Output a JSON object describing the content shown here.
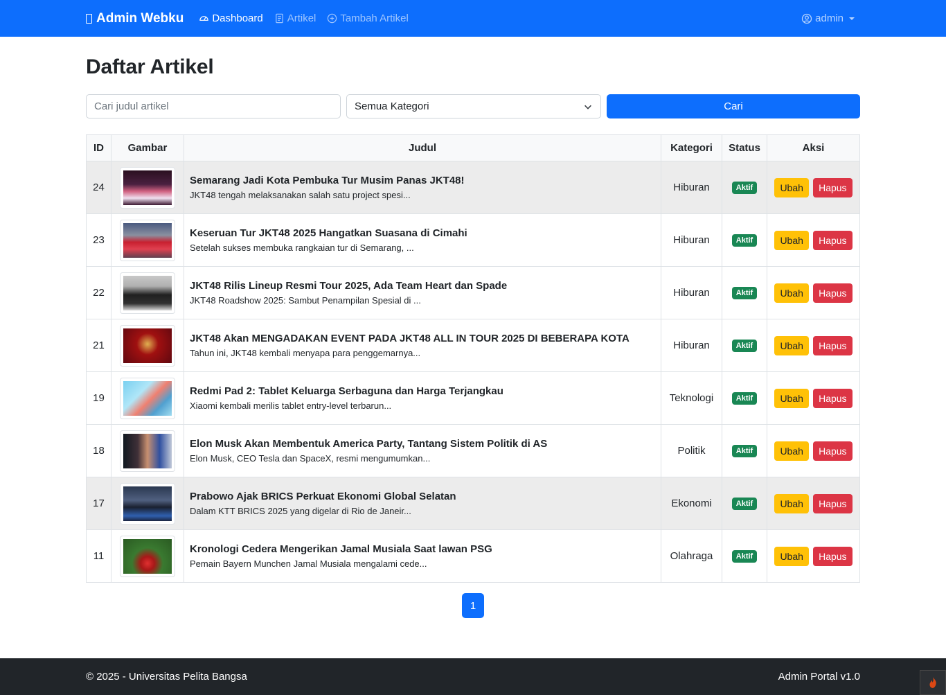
{
  "nav": {
    "brand": "Admin Webku",
    "links": [
      {
        "label": "Dashboard",
        "icon": "speedometer-icon",
        "active": true
      },
      {
        "label": "Artikel",
        "icon": "document-icon",
        "active": false
      },
      {
        "label": "Tambah Artikel",
        "icon": "plus-circle-icon",
        "active": false
      }
    ],
    "user": "admin"
  },
  "page": {
    "title": "Daftar Artikel"
  },
  "search": {
    "placeholder": "Cari judul artikel",
    "category_selected": "Semua Kategori",
    "button": "Cari"
  },
  "table": {
    "headers": [
      "ID",
      "Gambar",
      "Judul",
      "Kategori",
      "Status",
      "Aksi"
    ],
    "rows": [
      {
        "id": "24",
        "title": "Semarang Jadi Kota Pembuka Tur Musim Panas JKT48!",
        "desc": "JKT48 tengah melaksanakan salah satu project spesi...",
        "category": "Hiburan",
        "status": "Aktif",
        "edit": "Ubah",
        "delete": "Hapus",
        "highlight": true
      },
      {
        "id": "23",
        "title": "Keseruan Tur JKT48 2025 Hangatkan Suasana di Cimahi",
        "desc": "Setelah sukses membuka rangkaian tur di Semarang, ...",
        "category": "Hiburan",
        "status": "Aktif",
        "edit": "Ubah",
        "delete": "Hapus",
        "highlight": false
      },
      {
        "id": "22",
        "title": "JKT48 Rilis Lineup Resmi Tour 2025, Ada Team Heart dan Spade",
        "desc": "JKT48 Roadshow 2025: Sambut Penampilan Spesial di ...",
        "category": "Hiburan",
        "status": "Aktif",
        "edit": "Ubah",
        "delete": "Hapus",
        "highlight": false
      },
      {
        "id": "21",
        "title": "JKT48 Akan MENGADAKAN EVENT PADA JKT48 ALL IN TOUR 2025 DI BEBERAPA KOTA",
        "desc": "Tahun ini, JKT48 kembali menyapa para penggemarnya...",
        "category": "Hiburan",
        "status": "Aktif",
        "edit": "Ubah",
        "delete": "Hapus",
        "highlight": false
      },
      {
        "id": "19",
        "title": "Redmi Pad 2: Tablet Keluarga Serbaguna dan Harga Terjangkau",
        "desc": "Xiaomi kembali merilis tablet entry-level terbarun...",
        "category": "Teknologi",
        "status": "Aktif",
        "edit": "Ubah",
        "delete": "Hapus",
        "highlight": false
      },
      {
        "id": "18",
        "title": "Elon Musk Akan Membentuk America Party, Tantang Sistem Politik di AS",
        "desc": "Elon Musk, CEO Tesla dan SpaceX, resmi mengumumkan...",
        "category": "Politik",
        "status": "Aktif",
        "edit": "Ubah",
        "delete": "Hapus",
        "highlight": false
      },
      {
        "id": "17",
        "title": "Prabowo Ajak BRICS Perkuat Ekonomi Global Selatan",
        "desc": "Dalam KTT BRICS 2025 yang digelar di Rio de Janeir...",
        "category": "Ekonomi",
        "status": "Aktif",
        "edit": "Ubah",
        "delete": "Hapus",
        "highlight": true
      },
      {
        "id": "11",
        "title": "Kronologi Cedera Mengerikan Jamal Musiala Saat lawan PSG",
        "desc": "Pemain Bayern Munchen Jamal Musiala mengalami cede...",
        "category": "Olahraga",
        "status": "Aktif",
        "edit": "Ubah",
        "delete": "Hapus",
        "highlight": false
      }
    ]
  },
  "pagination": {
    "current": "1"
  },
  "footer": {
    "left": "© 2025 - Universitas Pelita Bangsa",
    "right": "Admin Portal v1.0"
  }
}
